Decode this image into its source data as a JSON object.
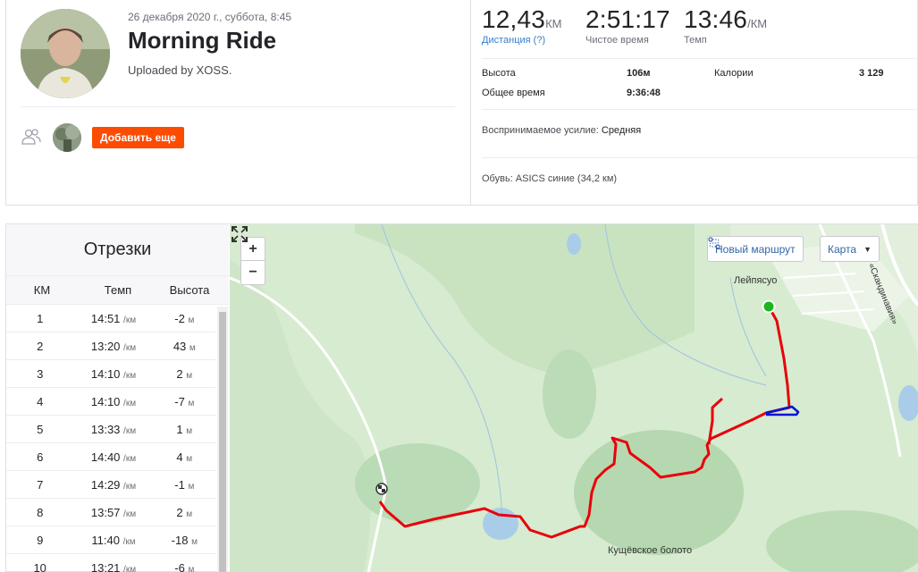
{
  "activity": {
    "date": "26 декабря 2020 г., суббота, 8:45",
    "title": "Morning Ride",
    "uploaded": "Uploaded by XOSS.",
    "add_button": "Добавить еще"
  },
  "stats": {
    "distance_value": "12,43",
    "distance_unit": "КМ",
    "distance_label": "Дистанция (?)",
    "moving_time_value": "2:51:17",
    "moving_time_label": "Чистое время",
    "pace_value": "13:46",
    "pace_unit": "/КМ",
    "pace_label": "Темп"
  },
  "details": {
    "elevation_label": "Высота",
    "elevation_value": "106м",
    "elapsed_label": "Общее время",
    "elapsed_value": "9:36:48",
    "calories_label": "Калории",
    "calories_value": "3 129",
    "effort_label": "Воспринимаемое усилие:",
    "effort_value": "Средняя",
    "shoes_text": "Обувь: ASICS синие (34,2 км)"
  },
  "splits": {
    "title": "Отрезки",
    "headers": [
      "КМ",
      "Темп",
      "Высота"
    ],
    "pace_unit": "/км",
    "elev_unit": "м",
    "rows": [
      {
        "km": "1",
        "pace": "14:51",
        "elev": "-2"
      },
      {
        "km": "2",
        "pace": "13:20",
        "elev": "43"
      },
      {
        "km": "3",
        "pace": "14:10",
        "elev": "2"
      },
      {
        "km": "4",
        "pace": "14:10",
        "elev": "-7"
      },
      {
        "km": "5",
        "pace": "13:33",
        "elev": "1"
      },
      {
        "km": "6",
        "pace": "14:40",
        "elev": "4"
      },
      {
        "km": "7",
        "pace": "14:29",
        "elev": "-1"
      },
      {
        "km": "8",
        "pace": "13:57",
        "elev": "2"
      },
      {
        "km": "9",
        "pace": "11:40",
        "elev": "-18"
      },
      {
        "km": "10",
        "pace": "13:21",
        "elev": "-6"
      }
    ]
  },
  "map": {
    "zoom_in": "+",
    "zoom_out": "−",
    "new_route": "Новый маршрут",
    "map_type": "Карта",
    "place_1": "Лейпясуо",
    "place_2": "Кущёвское болото",
    "road_label": "«Скандинавия»",
    "route_color": "#e8000b",
    "segment_color": "#0015d6",
    "start_color": "#1db51d"
  }
}
